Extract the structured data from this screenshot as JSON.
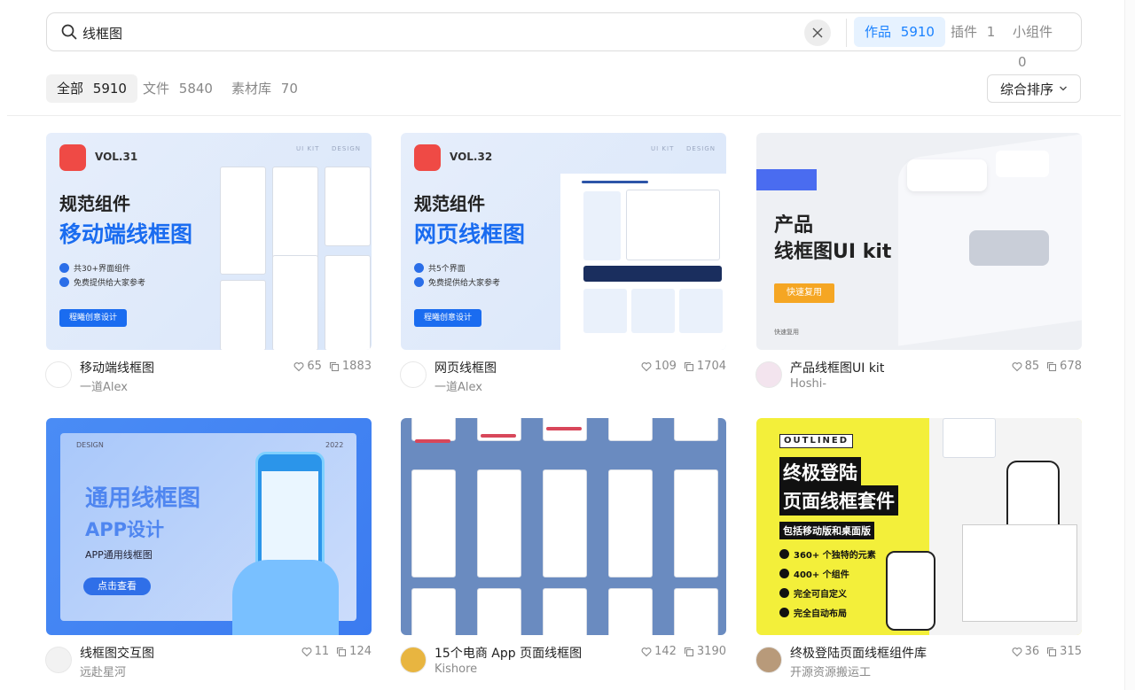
{
  "search": {
    "query": "线框图",
    "scopes": [
      {
        "label": "作品",
        "count": "5910",
        "active": true
      },
      {
        "label": "插件",
        "count": "1",
        "active": false
      },
      {
        "label": "小组件",
        "count": "0",
        "active": false
      }
    ]
  },
  "filters": [
    {
      "label": "全部",
      "count": "5910",
      "active": true
    },
    {
      "label": "文件",
      "count": "5840",
      "active": false
    },
    {
      "label": "素材库",
      "count": "70",
      "active": false
    }
  ],
  "sort": {
    "label": "综合排序"
  },
  "colors": {
    "accent": "#1b82ff",
    "brand_blue": "#1a6cf0",
    "logo_red": "#ef4a45",
    "yellow": "#f3ef3a",
    "grid_blue": "#6a8bc0"
  },
  "cards": [
    {
      "title": "移动端线框图",
      "author": "一道Alex",
      "likes": "65",
      "copies": "1883",
      "thumb": {
        "vol": "VOL.31",
        "kit": "UI KIT",
        "design": "DESIGN",
        "h1": "规范组件",
        "h2": "移动端线框图",
        "checks": [
          "共30+界面组件",
          "免费提供给大家参考"
        ],
        "cta": "程曦创意设计"
      }
    },
    {
      "title": "网页线框图",
      "author": "一道Alex",
      "likes": "109",
      "copies": "1704",
      "thumb": {
        "vol": "VOL.32",
        "kit": "UI KIT",
        "design": "DESIGN",
        "h1": "规范组件",
        "h2": "网页线框图",
        "checks": [
          "共5个界面",
          "免费提供给大家参考"
        ],
        "cta": "程曦创意设计"
      }
    },
    {
      "title": "产品线框图UI kit",
      "author": "Hoshi-",
      "likes": "85",
      "copies": "678",
      "thumb": {
        "h1": "产品",
        "h2": "线框图UI kit",
        "cta": "快速复用",
        "foot": "快速复用"
      }
    },
    {
      "title": "线框图交互图",
      "author": "远赴星河",
      "likes": "11",
      "copies": "124",
      "thumb": {
        "tag": "DESIGN",
        "year": "2022",
        "h1": "通用线框图",
        "h2": "APP设计",
        "sub": "APP通用线框图",
        "cta": "点击查看"
      }
    },
    {
      "title": "15个电商 App 页面线框图",
      "author": "Kishore",
      "likes": "142",
      "copies": "3190",
      "thumb": {}
    },
    {
      "title": "终极登陆页面线框组件库",
      "author": "开源资源搬运工",
      "likes": "36",
      "copies": "315",
      "thumb": {
        "badge": "OUTLINED",
        "h1": "终极登陆",
        "h2": "页面线框套件",
        "sub": "包括移动版和桌面版",
        "checks": [
          "360+ 个独特的元素",
          "400+ 个组件",
          "完全可自定义",
          "完全自动布局"
        ]
      }
    }
  ]
}
